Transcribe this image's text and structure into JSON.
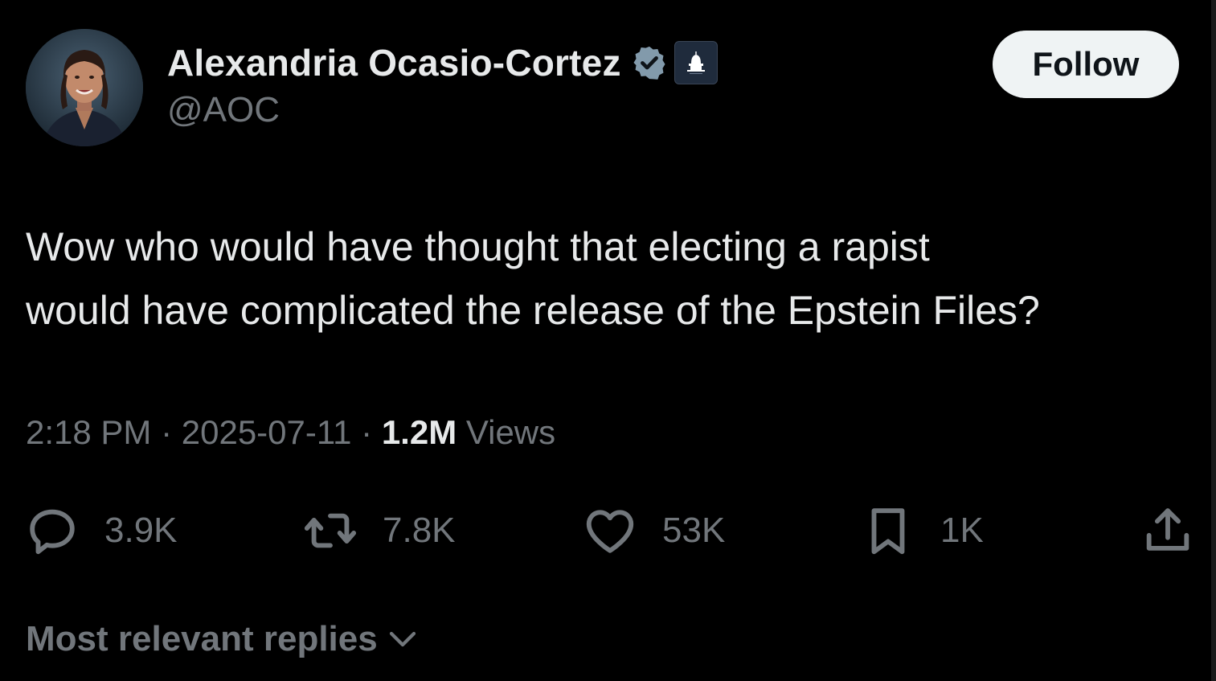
{
  "author": {
    "display_name": "Alexandria Ocasio-Cortez",
    "handle": "@AOC",
    "verified_color": "#829aab",
    "affiliation_icon": "capitol-dome-icon"
  },
  "follow_label": "Follow",
  "tweet": {
    "lines": [
      "Wow who would have thought that electing a rapist",
      "would have complicated the release of the Epstein Files?"
    ]
  },
  "meta": {
    "time": "2:18 PM",
    "sep1": " · ",
    "date": "2025-07-11",
    "sep2": " · ",
    "views_count": "1.2M",
    "views_label": " Views"
  },
  "actions": {
    "reply": {
      "icon": "reply-icon",
      "count": "3.9K"
    },
    "repost": {
      "icon": "repost-icon",
      "count": "7.8K"
    },
    "like": {
      "icon": "heart-icon",
      "count": "53K"
    },
    "bookmark": {
      "icon": "bookmark-icon",
      "count": "1K"
    },
    "share": {
      "icon": "share-icon"
    }
  },
  "replies_sort_label": "Most relevant replies"
}
